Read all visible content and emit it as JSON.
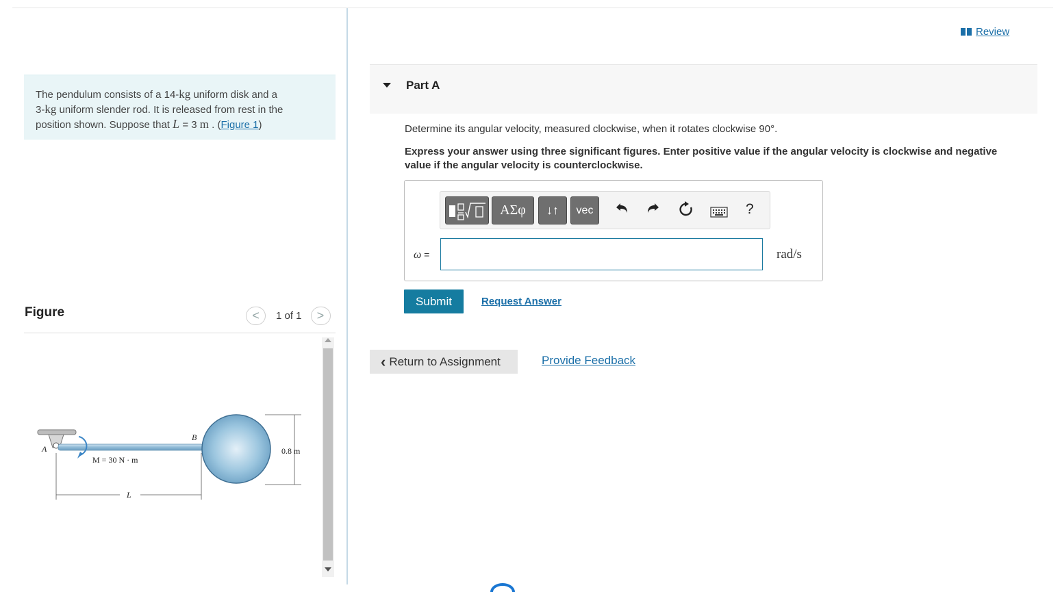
{
  "problem": {
    "text_1": "The pendulum consists of a 14-",
    "unit_kg_1": "kg",
    "text_2": " uniform disk and a",
    "text_3": "3-",
    "unit_kg_2": "kg",
    "text_4": " uniform slender rod. It is released from rest in the",
    "text_5": "position shown. Suppose that ",
    "var_L": "L",
    "text_6": " = 3 ",
    "unit_m": "m",
    "text_7": " . (",
    "figure_link": "Figure 1",
    "text_8": ")"
  },
  "figure_panel": {
    "title": "Figure",
    "pager_label": "1 of 1",
    "prev_glyph": "<",
    "next_glyph": ">",
    "labels": {
      "A": "A",
      "B": "B",
      "moment": "M = 30 N · m",
      "diameter": "0.8 m",
      "length": "L"
    }
  },
  "review": {
    "label": "Review"
  },
  "part": {
    "title": "Part A"
  },
  "question": {
    "prompt": "Determine its angular velocity, measured clockwise, when it rotates clockwise 90°.",
    "instruction": "Express your answer using three significant figures. Enter positive value if the angular velocity is clockwise and negative value if the angular velocity is counterclockwise."
  },
  "answer": {
    "variable": "ω",
    "equals": " =",
    "value": "",
    "unit": "rad/s",
    "toolbar": {
      "greek_label": "ΑΣφ",
      "arrows_label": "↓↑",
      "vec_label": "vec",
      "help_label": "?"
    }
  },
  "actions": {
    "submit": "Submit",
    "request_answer": "Request Answer",
    "return_label": "Return to Assignment",
    "feedback": "Provide Feedback"
  }
}
